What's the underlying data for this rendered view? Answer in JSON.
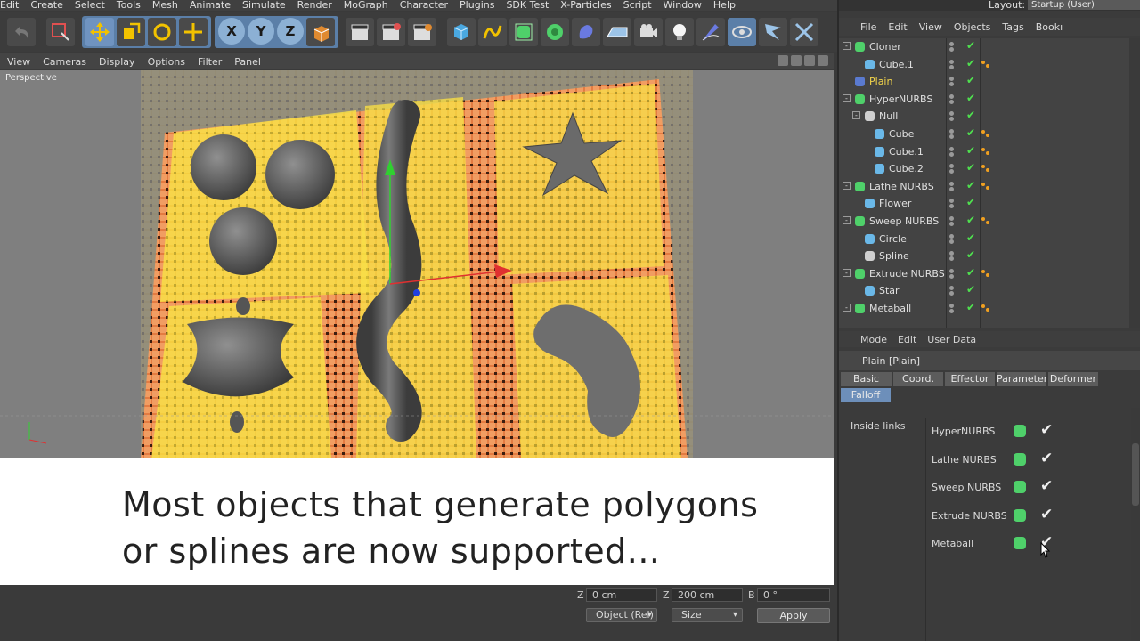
{
  "menubar": {
    "items": [
      "Edit",
      "Create",
      "Select",
      "Tools",
      "Mesh",
      "Animate",
      "Simulate",
      "Render",
      "MoGraph",
      "Character",
      "Plugins",
      "SDK Test",
      "X-Particles",
      "Script",
      "Window",
      "Help"
    ]
  },
  "layout": {
    "label": "Layout:",
    "value": "Startup (User)"
  },
  "toolbar": {
    "axis_x": "X",
    "axis_y": "Y",
    "axis_z": "Z"
  },
  "viewport_menu": {
    "items": [
      "View",
      "Cameras",
      "Display",
      "Options",
      "Filter",
      "Panel"
    ]
  },
  "viewport": {
    "label": "Perspective"
  },
  "caption": {
    "text": "Most objects that generate polygons\nor splines are now supported..."
  },
  "coordinates": {
    "z_label": "Z",
    "z_value": "0 cm",
    "z2_label": "Z",
    "z2_value": "200 cm",
    "b_label": "B",
    "b_value": "0 °",
    "mode_dropdown": "Object (Rel)",
    "size_dropdown": "Size",
    "apply_label": "Apply"
  },
  "object_manager": {
    "menu": [
      "File",
      "Edit",
      "View",
      "Objects",
      "Tags",
      "Bookı"
    ],
    "objects": [
      {
        "name": "Cloner",
        "indent": 0,
        "icon_color": "#4fd06a",
        "tree": "-",
        "tags": false
      },
      {
        "name": "Cube.1",
        "indent": 1,
        "icon_color": "#6ab8e8",
        "tree": "",
        "tags": true
      },
      {
        "name": "Plain",
        "indent": 0,
        "icon_color": "#5a7ad0",
        "tree": "",
        "tags": false,
        "highlight": true
      },
      {
        "name": "HyperNURBS",
        "indent": 0,
        "icon_color": "#4fd06a",
        "tree": "-",
        "tags": false
      },
      {
        "name": "Null",
        "indent": 1,
        "icon_color": "#cfcfcf",
        "tree": "-",
        "tags": false
      },
      {
        "name": "Cube",
        "indent": 2,
        "icon_color": "#6ab8e8",
        "tree": "",
        "tags": true
      },
      {
        "name": "Cube.1",
        "indent": 2,
        "icon_color": "#6ab8e8",
        "tree": "",
        "tags": true
      },
      {
        "name": "Cube.2",
        "indent": 2,
        "icon_color": "#6ab8e8",
        "tree": "",
        "tags": true
      },
      {
        "name": "Lathe NURBS",
        "indent": 0,
        "icon_color": "#4fd06a",
        "tree": "-",
        "tags": true
      },
      {
        "name": "Flower",
        "indent": 1,
        "icon_color": "#6ab8e8",
        "tree": "",
        "tags": false
      },
      {
        "name": "Sweep NURBS",
        "indent": 0,
        "icon_color": "#4fd06a",
        "tree": "-",
        "tags": true
      },
      {
        "name": "Circle",
        "indent": 1,
        "icon_color": "#6ab8e8",
        "tree": "",
        "tags": false
      },
      {
        "name": "Spline",
        "indent": 1,
        "icon_color": "#cfcfcf",
        "tree": "",
        "tags": false
      },
      {
        "name": "Extrude NURBS",
        "indent": 0,
        "icon_color": "#4fd06a",
        "tree": "-",
        "tags": true
      },
      {
        "name": "Star",
        "indent": 1,
        "icon_color": "#6ab8e8",
        "tree": "",
        "tags": false
      },
      {
        "name": "Metaball",
        "indent": 0,
        "icon_color": "#4fd06a",
        "tree": "-",
        "tags": true
      }
    ]
  },
  "attribute_manager": {
    "menu": [
      "Mode",
      "Edit",
      "User Data"
    ],
    "title": "Plain [Plain]",
    "tabs": [
      "Basic",
      "Coord.",
      "Effector",
      "Parameter",
      "Deformer",
      "Falloff"
    ],
    "active_tab": "Falloff",
    "inside_links_label": "Inside links",
    "links": [
      {
        "name": "HyperNURBS",
        "icon_color": "#4fd06a"
      },
      {
        "name": "Lathe NURBS",
        "icon_color": "#4fd06a"
      },
      {
        "name": "Sweep NURBS",
        "icon_color": "#4fd06a"
      },
      {
        "name": "Extrude NURBS",
        "icon_color": "#4fd06a"
      },
      {
        "name": "Metaball",
        "icon_color": "#4fd06a"
      }
    ]
  },
  "colors": {
    "accent_blue": "#5b7fa8",
    "tab_active": "#6d8fba",
    "check_green": "#4fe04f",
    "tag_orange": "#f0a020",
    "highlight_yellow": "#f2d44a"
  }
}
